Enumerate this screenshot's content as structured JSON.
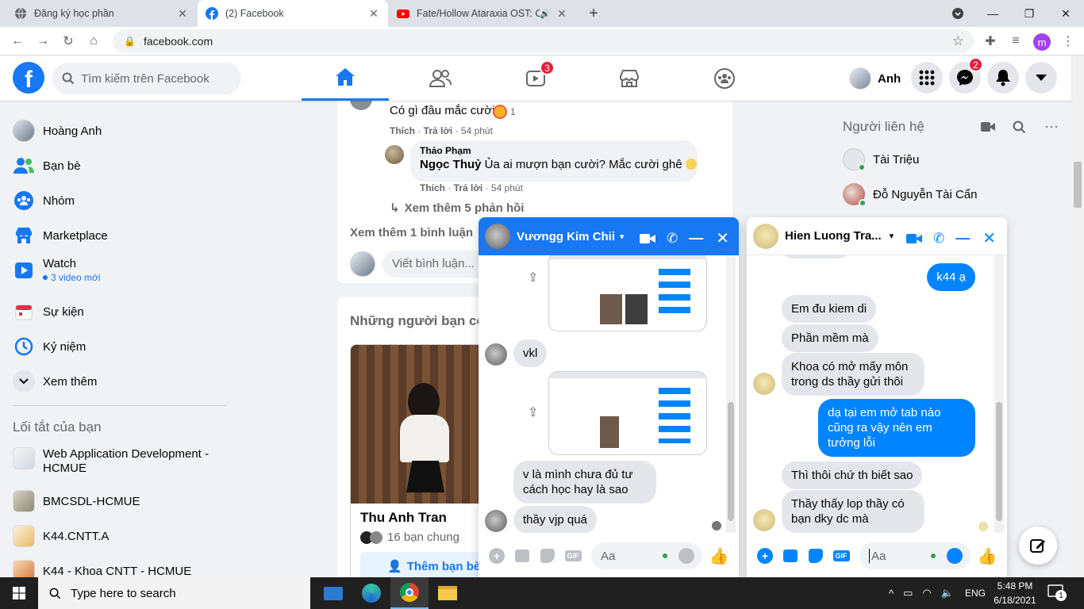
{
  "browser": {
    "tabs": [
      {
        "title": "Đăng ký học phần",
        "active": false
      },
      {
        "title": "(2) Facebook",
        "active": true
      },
      {
        "title": "Fate/Hollow Ataraxia OST: Cả",
        "active": false
      }
    ],
    "new_tab": "+",
    "url": "facebook.com",
    "profile_letter": "m"
  },
  "header": {
    "search_placeholder": "Tìm kiếm trên Facebook",
    "watch_badge": "3",
    "user_name": "Anh",
    "messenger_badge": "2"
  },
  "sidebar": {
    "items": [
      {
        "label": "Hoàng Anh",
        "icon": "avatar"
      },
      {
        "label": "Bạn bè",
        "icon": "friends-icon"
      },
      {
        "label": "Nhóm",
        "icon": "groups-icon"
      },
      {
        "label": "Marketplace",
        "icon": "marketplace-icon"
      },
      {
        "label": "Watch",
        "sub": "3 video mới",
        "icon": "watch-icon"
      },
      {
        "label": "Sự kiện",
        "icon": "events-icon"
      },
      {
        "label": "Kỷ niệm",
        "icon": "memories-icon"
      },
      {
        "label": "Xem thêm",
        "icon": "chevron-down-icon"
      }
    ],
    "shortcuts_title": "Lối tắt của bạn",
    "shortcuts": [
      {
        "label": "Web Application Development - HCMUE"
      },
      {
        "label": "BMCSDL-HCMUE"
      },
      {
        "label": "K44.CNTT.A"
      },
      {
        "label": "K44 - Khoa CNTT - HCMUE"
      }
    ]
  },
  "feed": {
    "comment1": {
      "text": "Có gì đâu mắc cười",
      "reaction_count": "1",
      "like": "Thích",
      "reply": "Trả lời",
      "time": "54 phút"
    },
    "comment2": {
      "author": "Thảo Phạm",
      "mention": "Ngọc Thuỷ",
      "text": "Ủa ai mượn bạn cười? Mắc cười ghê",
      "like": "Thích",
      "reply": "Trả lời",
      "time": "54 phút"
    },
    "more_replies": "Xem thêm 5 phản hồi",
    "more_comments": "Xem thêm 1 bình luận",
    "write_comment": "Viết bình luận...",
    "suggest_title": "Những người bạn có",
    "suggest_person": {
      "name": "Thu Anh Tran",
      "mutual": "16 bạn chung",
      "add_label": "Thêm bạn bè"
    }
  },
  "contacts": {
    "title": "Người liên hệ",
    "items": [
      {
        "name": "Tài Triệu"
      },
      {
        "name": "Đỗ Nguyễn Tài Cẩn"
      }
    ]
  },
  "chat1": {
    "name": "Vươngg Kim Chii",
    "messages": [
      {
        "from": "them",
        "text": "vkl"
      },
      {
        "from": "them",
        "text": "v là mình chưa đủ tư cách học hay là sao"
      },
      {
        "from": "them",
        "text": "thầy vjp quá"
      }
    ],
    "input_placeholder": "Aa",
    "gif": "GIF"
  },
  "chat2": {
    "name": "Hien Luong Tra...",
    "messages": [
      {
        "from": "me",
        "text": "k44 ạ"
      },
      {
        "from": "them",
        "text": "Em đu kiem di"
      },
      {
        "from": "them",
        "text": "Phần mềm mà"
      },
      {
        "from": "them",
        "text": "Khoa có mở mấy môn trong ds thầy gửi thôi"
      },
      {
        "from": "me",
        "text": "dạ tại em mở tab nào cũng ra vậy nên em tưởng lỗi"
      },
      {
        "from": "them",
        "text": "Thì thôi chứ th biết sao"
      },
      {
        "from": "them",
        "text": "Thầy thấy lop thầy có bạn dky dc mà"
      }
    ],
    "input_placeholder": "Aa",
    "gif": "GIF"
  },
  "taskbar": {
    "search_placeholder": "Type here to search",
    "lang": "ENG",
    "time": "5:48 PM",
    "date": "6/18/2021",
    "notif_count": "1"
  },
  "colors": {
    "fb_blue": "#1877f2",
    "messenger_blue": "#0084ff",
    "bg": "#f0f2f5"
  }
}
